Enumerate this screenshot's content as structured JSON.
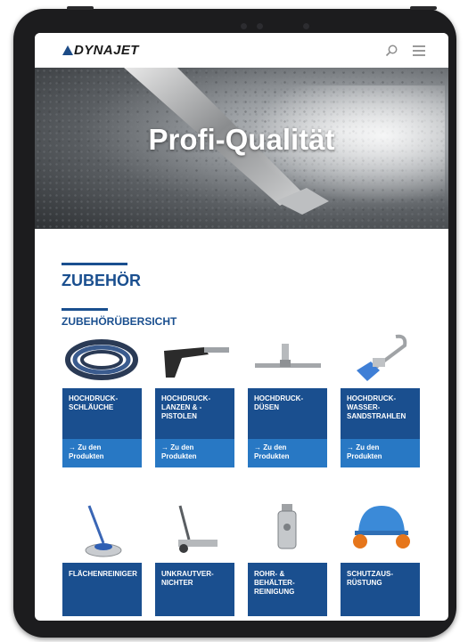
{
  "header": {
    "logo_text": "DYNAJET"
  },
  "hero": {
    "title": "Profi-Qualität"
  },
  "section": {
    "title": "ZUBEHÖR",
    "subtitle": "ZUBEHÖRÜBERSICHT"
  },
  "products_row1": [
    {
      "label": "HOCHDRUCK-\nSCHLÄUCHE",
      "link": "→ Zu den\nProdukten"
    },
    {
      "label": "HOCHDRUCK-\nLANZEN & -\nPISTOLEN",
      "link": "→ Zu den\nProdukten"
    },
    {
      "label": "HOCHDRUCK-\nDÜSEN",
      "link": "→ Zu den\nProdukten"
    },
    {
      "label": "HOCHDRUCK-\nWASSER-\nSANDSTRAHLEN",
      "link": "→ Zu den\nProdukten"
    }
  ],
  "products_row2": [
    {
      "label": "FLÄCHENREINIGER"
    },
    {
      "label": "UNKRAUTVER-\nNICHTER"
    },
    {
      "label": "ROHR- &\nBEHÄLTER-\nREINIGUNG"
    },
    {
      "label": "SCHUTZAUS-\nRÜSTUNG"
    }
  ],
  "colors": {
    "brand_blue": "#1a4f8f",
    "link_blue": "#2878c4"
  },
  "icons": [
    "search-icon",
    "menu-icon"
  ]
}
